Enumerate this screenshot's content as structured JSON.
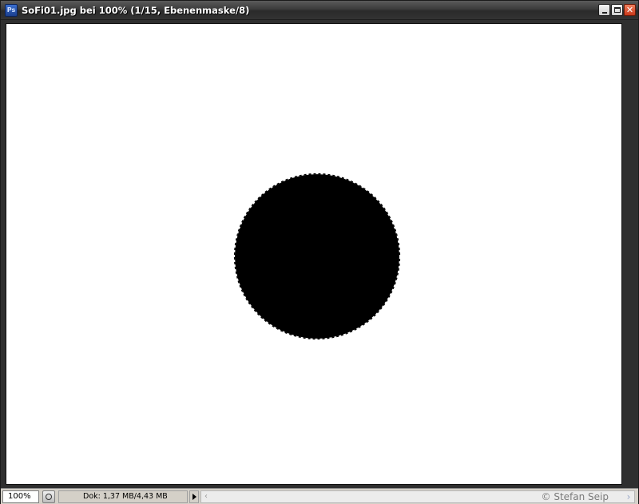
{
  "window": {
    "title": "SoFi01.jpg bei 100% (1/15, Ebenenmaske/8)",
    "app_icon_label": "Ps",
    "app_icon": "photoshop-icon",
    "minimize_icon": "minimize-icon",
    "maximize_icon": "maximize-icon",
    "close_icon": "close-icon",
    "close_glyph": "✕"
  },
  "canvas": {
    "background": "#ffffff",
    "mask_fill": "#000000",
    "selection": "marching-ants"
  },
  "statusbar": {
    "zoom": "100%",
    "doc_info": "Dok: 1,37 MB/4,43 MB",
    "status_menu_icon": "play-triangle-icon",
    "scroll_left_glyph": "‹",
    "scroll_right_glyph": "›",
    "watermark": "© Stefan Seip"
  },
  "colors": {
    "titlebar": "#3b3b3b",
    "statusbar": "#d4d0c8",
    "close_button": "#d9532f"
  }
}
